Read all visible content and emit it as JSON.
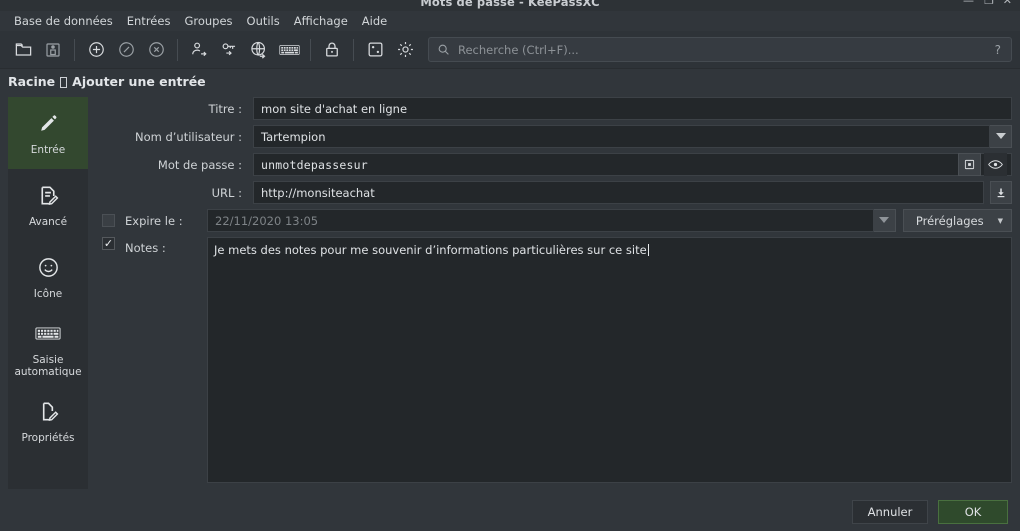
{
  "window": {
    "title": "Mots de passe - KeePassXC",
    "controls": {
      "minimize": "—",
      "maximize": "❐",
      "close": "✕"
    }
  },
  "menubar": {
    "items": [
      {
        "label": "Base de données",
        "name": "menu-base-de-donnees"
      },
      {
        "label": "Entrées",
        "name": "menu-entrees"
      },
      {
        "label": "Groupes",
        "name": "menu-groupes"
      },
      {
        "label": "Outils",
        "name": "menu-outils"
      },
      {
        "label": "Affichage",
        "name": "menu-affichage"
      },
      {
        "label": "Aide",
        "name": "menu-aide"
      }
    ]
  },
  "toolbar": {
    "icons": [
      "open-database-icon",
      "save-database-icon",
      "add-entry-icon",
      "edit-entry-icon",
      "delete-entry-icon",
      "copy-username-icon",
      "copy-password-icon",
      "open-url-icon",
      "auto-type-icon",
      "lock-database-icon",
      "password-generator-icon",
      "settings-icon"
    ],
    "search": {
      "placeholder": "Recherche (Ctrl+F)...",
      "value": "",
      "help": "?"
    }
  },
  "breadcrumb": {
    "group": "Racine",
    "page": "Ajouter une entrée"
  },
  "sidebar": {
    "items": [
      {
        "label": "Entrée",
        "icon": "pencil-icon",
        "active": true
      },
      {
        "label": "Avancé",
        "icon": "document-edit-icon",
        "active": false
      },
      {
        "label": "Icône",
        "icon": "smiley-icon",
        "active": false
      },
      {
        "label": "Saisie automatique",
        "icon": "keyboard-icon",
        "active": false
      },
      {
        "label": "Propriétés",
        "icon": "properties-icon",
        "active": false
      }
    ]
  },
  "form": {
    "title": {
      "label": "Titre :",
      "value": "mon site d'achat en ligne"
    },
    "username": {
      "label": "Nom d’utilisateur :",
      "value": "Tartempion"
    },
    "password": {
      "label": "Mot de passe :",
      "value": "unmotdepassesur"
    },
    "url": {
      "label": "URL :",
      "value": "http://monsiteachat"
    },
    "expires": {
      "label": "Expire le :",
      "value": "22/11/2020 13:05",
      "checked": false,
      "presets_label": "Préréglages"
    },
    "notes": {
      "label": "Notes :",
      "checked": true,
      "value": "Je mets des notes pour me souvenir d’informations particulières sur ce site"
    }
  },
  "footer": {
    "cancel_label": "Annuler",
    "ok_label": "OK"
  },
  "colors": {
    "accent_green": "#33482f",
    "ok_button": "#2f4a2c",
    "window_bg": "#31363b",
    "input_bg": "#23272a"
  }
}
